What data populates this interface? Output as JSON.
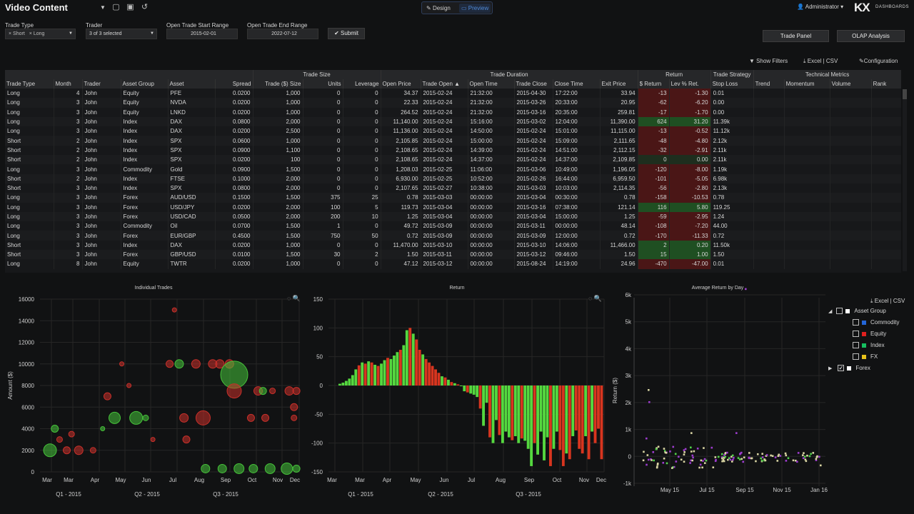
{
  "app": {
    "title": "Video Content",
    "mode_design": "Design",
    "mode_preview": "Preview",
    "user": "Administrator",
    "logo": "KX",
    "logo_sub": "DASHBOARDS"
  },
  "filters": {
    "trade_type_label": "Trade Type",
    "trade_type_chips": [
      "Short",
      "Long"
    ],
    "trader_label": "Trader",
    "trader_value": "3 of 3 selected",
    "start_label": "Open Trade Start Range",
    "start_value": "2015-02-01",
    "end_label": "Open Trade End Range",
    "end_value": "2022-07-12",
    "submit": "Submit"
  },
  "right_buttons": {
    "trade_panel": "Trade Panel",
    "olap": "OLAP Analysis"
  },
  "toolbar": {
    "show_filters": "Show Filters",
    "export": "Excel | CSV",
    "configuration": "Configuration"
  },
  "grid": {
    "groups": [
      {
        "label": "",
        "span": 6
      },
      {
        "label": "Trade Size",
        "span": 3
      },
      {
        "label": "Trade Duration",
        "span": 6
      },
      {
        "label": "Return",
        "span": 2
      },
      {
        "label": "Trade Strategy",
        "span": 1
      },
      {
        "label": "Technical Metrics",
        "span": 4
      }
    ],
    "columns": [
      "Trade Type",
      "Month",
      "Trader",
      "Asset Group",
      "Asset",
      "Spread",
      "Trade ($) Size",
      "Units",
      "Leverage",
      "Open Price",
      "Trade Open ▲",
      "Open Time",
      "Trade Close",
      "Close Time",
      "Exit Price",
      "$ Return",
      "Lev % Ret.",
      "Stop Loss",
      "Trend",
      "Momentum",
      "Volume",
      "Rank"
    ],
    "rows": [
      [
        "Long",
        "4",
        "John",
        "Equity",
        "PFE",
        "0.0200",
        "1,000",
        "0",
        "0",
        "34.37",
        "2015-02-24",
        "21:32:00",
        "2015-04-30",
        "17:22:00",
        "33.94",
        "-13",
        "-1.30",
        "0.01"
      ],
      [
        "Long",
        "3",
        "John",
        "Equity",
        "NVDA",
        "0.0200",
        "1,000",
        "0",
        "0",
        "22.33",
        "2015-02-24",
        "21:32:00",
        "2015-03-26",
        "20:33:00",
        "20.95",
        "-62",
        "-6.20",
        "0.00"
      ],
      [
        "Long",
        "3",
        "John",
        "Equity",
        "LNKD",
        "0.0200",
        "1,000",
        "0",
        "0",
        "264.52",
        "2015-02-24",
        "21:32:00",
        "2015-03-16",
        "20:35:00",
        "259.81",
        "-17",
        "-1.70",
        "0.00"
      ],
      [
        "Long",
        "3",
        "John",
        "Index",
        "DAX",
        "0.0800",
        "2,000",
        "0",
        "0",
        "11,140.00",
        "2015-02-24",
        "15:16:00",
        "2015-03-02",
        "12:04:00",
        "11,390.00",
        "624",
        "31.20",
        "11.39k"
      ],
      [
        "Long",
        "3",
        "John",
        "Index",
        "DAX",
        "0.0200",
        "2,500",
        "0",
        "0",
        "11,136.00",
        "2015-02-24",
        "14:50:00",
        "2015-02-24",
        "15:01:00",
        "11,115.00",
        "-13",
        "-0.52",
        "11.12k"
      ],
      [
        "Short",
        "2",
        "John",
        "Index",
        "SPX",
        "0.0600",
        "1,000",
        "0",
        "0",
        "2,105.85",
        "2015-02-24",
        "15:00:00",
        "2015-02-24",
        "15:09:00",
        "2,111.65",
        "-48",
        "-4.80",
        "2.12k"
      ],
      [
        "Short",
        "2",
        "John",
        "Index",
        "SPX",
        "0.0900",
        "1,100",
        "0",
        "0",
        "2,108.65",
        "2015-02-24",
        "14:39:00",
        "2015-02-24",
        "14:51:00",
        "2,112.15",
        "-32",
        "-2.91",
        "2.11k"
      ],
      [
        "Short",
        "2",
        "John",
        "Index",
        "SPX",
        "0.0200",
        "100",
        "0",
        "0",
        "2,108.65",
        "2015-02-24",
        "14:37:00",
        "2015-02-24",
        "14:37:00",
        "2,109.85",
        "0",
        "0.00",
        "2.11k"
      ],
      [
        "Long",
        "3",
        "John",
        "Commodity",
        "Gold",
        "0.0900",
        "1,500",
        "0",
        "0",
        "1,208.03",
        "2015-02-25",
        "11:06:00",
        "2015-03-06",
        "10:49:00",
        "1,196.05",
        "-120",
        "-8.00",
        "1.19k"
      ],
      [
        "Short",
        "2",
        "John",
        "Index",
        "FTSE",
        "0.1000",
        "2,000",
        "0",
        "0",
        "6,930.00",
        "2015-02-25",
        "10:52:00",
        "2015-02-26",
        "16:44:00",
        "6,959.50",
        "-101",
        "-5.05",
        "6.98k"
      ],
      [
        "Short",
        "3",
        "John",
        "Index",
        "SPX",
        "0.0800",
        "2,000",
        "0",
        "0",
        "2,107.65",
        "2015-02-27",
        "10:38:00",
        "2015-03-03",
        "10:03:00",
        "2,114.35",
        "-56",
        "-2.80",
        "2.13k"
      ],
      [
        "Long",
        "3",
        "John",
        "Forex",
        "AUD/USD",
        "0.1500",
        "1,500",
        "375",
        "25",
        "0.78",
        "2015-03-03",
        "00:00:00",
        "2015-03-04",
        "00:30:00",
        "0.78",
        "-158",
        "-10.53",
        "0.78"
      ],
      [
        "Long",
        "3",
        "John",
        "Forex",
        "USD/JPY",
        "0.0200",
        "2,000",
        "100",
        "5",
        "119.73",
        "2015-03-04",
        "00:00:00",
        "2015-03-16",
        "07:38:00",
        "121.14",
        "116",
        "5.80",
        "119.25"
      ],
      [
        "Long",
        "3",
        "John",
        "Forex",
        "USD/CAD",
        "0.0500",
        "2,000",
        "200",
        "10",
        "1.25",
        "2015-03-04",
        "00:00:00",
        "2015-03-04",
        "15:00:00",
        "1.25",
        "-59",
        "-2.95",
        "1.24"
      ],
      [
        "Long",
        "3",
        "John",
        "Commodity",
        "Oil",
        "0.0700",
        "1,500",
        "1",
        "0",
        "49.72",
        "2015-03-09",
        "00:00:00",
        "2015-03-11",
        "00:00:00",
        "48.14",
        "-108",
        "-7.20",
        "44.00"
      ],
      [
        "Long",
        "3",
        "John",
        "Forex",
        "EUR/GBP",
        "0.4500",
        "1,500",
        "750",
        "50",
        "0.72",
        "2015-03-09",
        "00:00:00",
        "2015-03-09",
        "12:00:00",
        "0.72",
        "-170",
        "-11.33",
        "0.72"
      ],
      [
        "Short",
        "3",
        "John",
        "Index",
        "DAX",
        "0.0200",
        "1,000",
        "0",
        "0",
        "11,470.00",
        "2015-03-10",
        "00:00:00",
        "2015-03-10",
        "14:06:00",
        "11,466.00",
        "2",
        "0.20",
        "11.50k"
      ],
      [
        "Short",
        "3",
        "John",
        "Forex",
        "GBP/USD",
        "0.0100",
        "1,500",
        "30",
        "2",
        "1.50",
        "2015-03-11",
        "00:00:00",
        "2015-03-12",
        "09:46:00",
        "1.50",
        "15",
        "1.00",
        "1.50"
      ],
      [
        "Long",
        "8",
        "John",
        "Equity",
        "TWTR",
        "0.0200",
        "1,000",
        "0",
        "0",
        "47.12",
        "2015-03-12",
        "00:00:00",
        "2015-08-24",
        "14:19:00",
        "24.96",
        "-470",
        "-47.00",
        "0.01"
      ]
    ]
  },
  "chart_data": [
    {
      "type": "scatter",
      "title": "Individual Trades",
      "ylabel": "Amount ($)",
      "ylim": [
        0,
        16000
      ],
      "yticks": [
        "16000",
        "14000",
        "12000",
        "10000",
        "8000",
        "6000",
        "4000",
        "2000",
        "0"
      ],
      "xticks": [
        "Mar",
        "Mar",
        "Apr",
        "May",
        "Jun",
        "Jul",
        "Aug",
        "Sep",
        "Oct",
        "Nov",
        "Dec"
      ],
      "quarters": [
        "Q1 - 2015",
        "Q2 - 2015",
        "Q3 - 2015"
      ],
      "points": [
        {
          "m": 0.3,
          "y": 2000,
          "r": 9,
          "c": "g"
        },
        {
          "m": 0.5,
          "y": 4000,
          "r": 5,
          "c": "g"
        },
        {
          "m": 0.7,
          "y": 3000,
          "r": 4,
          "c": "r"
        },
        {
          "m": 1.0,
          "y": 2000,
          "r": 5,
          "c": "r"
        },
        {
          "m": 1.2,
          "y": 3500,
          "r": 4,
          "c": "r"
        },
        {
          "m": 1.5,
          "y": 2000,
          "r": 6,
          "c": "r"
        },
        {
          "m": 2.1,
          "y": 2000,
          "r": 4,
          "c": "r"
        },
        {
          "m": 2.5,
          "y": 4000,
          "r": 3,
          "c": "g"
        },
        {
          "m": 2.7,
          "y": 7000,
          "r": 5,
          "c": "r"
        },
        {
          "m": 3.0,
          "y": 5000,
          "r": 8,
          "c": "g"
        },
        {
          "m": 3.3,
          "y": 10000,
          "r": 3,
          "c": "r"
        },
        {
          "m": 3.6,
          "y": 8000,
          "r": 3,
          "c": "r"
        },
        {
          "m": 3.9,
          "y": 5000,
          "r": 9,
          "c": "g"
        },
        {
          "m": 4.3,
          "y": 5000,
          "r": 4,
          "c": "g"
        },
        {
          "m": 4.6,
          "y": 3000,
          "r": 3,
          "c": "r"
        },
        {
          "m": 5.3,
          "y": 10000,
          "r": 5,
          "c": "r"
        },
        {
          "m": 5.7,
          "y": 10000,
          "r": 6,
          "c": "g"
        },
        {
          "m": 5.9,
          "y": 5000,
          "r": 6,
          "c": "r"
        },
        {
          "m": 6.0,
          "y": 3000,
          "r": 5,
          "c": "r"
        },
        {
          "m": 6.4,
          "y": 10000,
          "r": 6,
          "c": "r"
        },
        {
          "m": 6.7,
          "y": 5000,
          "r": 10,
          "c": "r"
        },
        {
          "m": 7.1,
          "y": 10000,
          "r": 6,
          "c": "r"
        },
        {
          "m": 7.4,
          "y": 10000,
          "r": 6,
          "c": "r"
        },
        {
          "m": 7.8,
          "y": 10000,
          "r": 6,
          "c": "r"
        },
        {
          "m": 8.0,
          "y": 9000,
          "r": 19,
          "c": "g"
        },
        {
          "m": 8.0,
          "y": 7500,
          "r": 10,
          "c": "r"
        },
        {
          "m": 8.7,
          "y": 5000,
          "r": 5,
          "c": "r"
        },
        {
          "m": 9.0,
          "y": 7500,
          "r": 6,
          "c": "r"
        },
        {
          "m": 9.2,
          "y": 7500,
          "r": 5,
          "c": "g"
        },
        {
          "m": 9.3,
          "y": 5000,
          "r": 5,
          "c": "r"
        },
        {
          "m": 9.6,
          "y": 7500,
          "r": 4,
          "c": "r"
        },
        {
          "m": 10.3,
          "y": 7500,
          "r": 6,
          "c": "r"
        },
        {
          "m": 10.5,
          "y": 6000,
          "r": 5,
          "c": "r"
        },
        {
          "m": 10.6,
          "y": 7500,
          "r": 5,
          "c": "r"
        },
        {
          "m": 10.5,
          "y": 5000,
          "r": 4,
          "c": "r"
        },
        {
          "m": 5.5,
          "y": 15000,
          "r": 3,
          "c": "r"
        },
        {
          "m": 6.8,
          "y": 300,
          "r": 6,
          "c": "g"
        },
        {
          "m": 7.5,
          "y": 300,
          "r": 6,
          "c": "g"
        },
        {
          "m": 8.2,
          "y": 300,
          "r": 7,
          "c": "g"
        },
        {
          "m": 8.8,
          "y": 300,
          "r": 6,
          "c": "g"
        },
        {
          "m": 9.5,
          "y": 300,
          "r": 7,
          "c": "g"
        },
        {
          "m": 10.2,
          "y": 300,
          "r": 8,
          "c": "g"
        },
        {
          "m": 10.6,
          "y": 300,
          "r": 5,
          "c": "g"
        }
      ]
    },
    {
      "type": "bar",
      "title": "Return",
      "ylim": [
        -150,
        150
      ],
      "yticks": [
        "150",
        "100",
        "50",
        "0",
        "-50",
        "-100",
        "-150"
      ],
      "xticks": [
        "Mar",
        "Mar",
        "Apr",
        "May",
        "Jun",
        "Jul",
        "Aug",
        "Sep",
        "Oct",
        "Nov",
        "Dec"
      ],
      "quarters": [
        "Q1 - 2015",
        "Q2 - 2015",
        "Q3 - 2015"
      ],
      "values": [
        3,
        5,
        8,
        12,
        18,
        28,
        35,
        40,
        38,
        42,
        40,
        36,
        34,
        38,
        44,
        48,
        46,
        52,
        58,
        62,
        70,
        96,
        100,
        90,
        80,
        62,
        54,
        46,
        40,
        34,
        28,
        22,
        16,
        14,
        10,
        6,
        4,
        2,
        0,
        -10,
        -12,
        -14,
        -16,
        -20,
        -40,
        -70,
        -30,
        -90,
        -100,
        -60,
        -86,
        -100,
        -80,
        -90,
        -95,
        -88,
        -100,
        -92,
        -96,
        -110,
        -140,
        -100,
        -120,
        -80,
        -130,
        -90,
        -140,
        -110,
        -80,
        -112,
        -140,
        -118,
        -128,
        -88,
        -78,
        -110,
        -118,
        -88,
        -128,
        -80,
        -100,
        -75,
        -128
      ],
      "colors": [
        "g",
        "g",
        "g",
        "g",
        "g",
        "g",
        "r",
        "g",
        "r",
        "g",
        "r",
        "g",
        "r",
        "g",
        "g",
        "r",
        "g",
        "g",
        "g",
        "r",
        "g",
        "g",
        "r",
        "g",
        "r",
        "r",
        "g",
        "r",
        "r",
        "r",
        "r",
        "r",
        "g",
        "r",
        "g",
        "r",
        "g",
        "r",
        "g",
        "g",
        "r",
        "g",
        "g",
        "g",
        "r",
        "g",
        "g",
        "r",
        "g",
        "g",
        "r",
        "g",
        "g",
        "g",
        "r",
        "g",
        "g",
        "r",
        "g",
        "g",
        "g",
        "r",
        "g",
        "g",
        "g",
        "g",
        "r",
        "g",
        "g",
        "r",
        "r",
        "g",
        "r",
        "g",
        "r",
        "r",
        "r",
        "g",
        "r",
        "g",
        "r",
        "r",
        "r"
      ]
    },
    {
      "type": "scatter",
      "title": "Average Return by Day",
      "ylabel": "Return ($)",
      "ylim": [
        -1000,
        6000
      ],
      "yticks": [
        "6k",
        "5k",
        "4k",
        "3k",
        "2k",
        "1k",
        "0",
        "-1k"
      ],
      "xticks": [
        "May 15",
        "Jul 15",
        "Sep 15",
        "Nov 15",
        "Jan 16"
      ],
      "export": "Excel | CSV",
      "legend_title": "Asset Group",
      "legend_items": [
        {
          "name": "Commodity",
          "color": "#2466d8"
        },
        {
          "name": "Equity",
          "color": "#e0201f"
        },
        {
          "name": "Index",
          "color": "#16c060"
        },
        {
          "name": "FX",
          "color": "#e8c21b"
        }
      ],
      "legend_other": "Forex",
      "colors": {
        "green": "#52d14a",
        "red": "#d33333",
        "purple": "#9c3ccd",
        "cream": "#d8d4a2"
      }
    }
  ]
}
